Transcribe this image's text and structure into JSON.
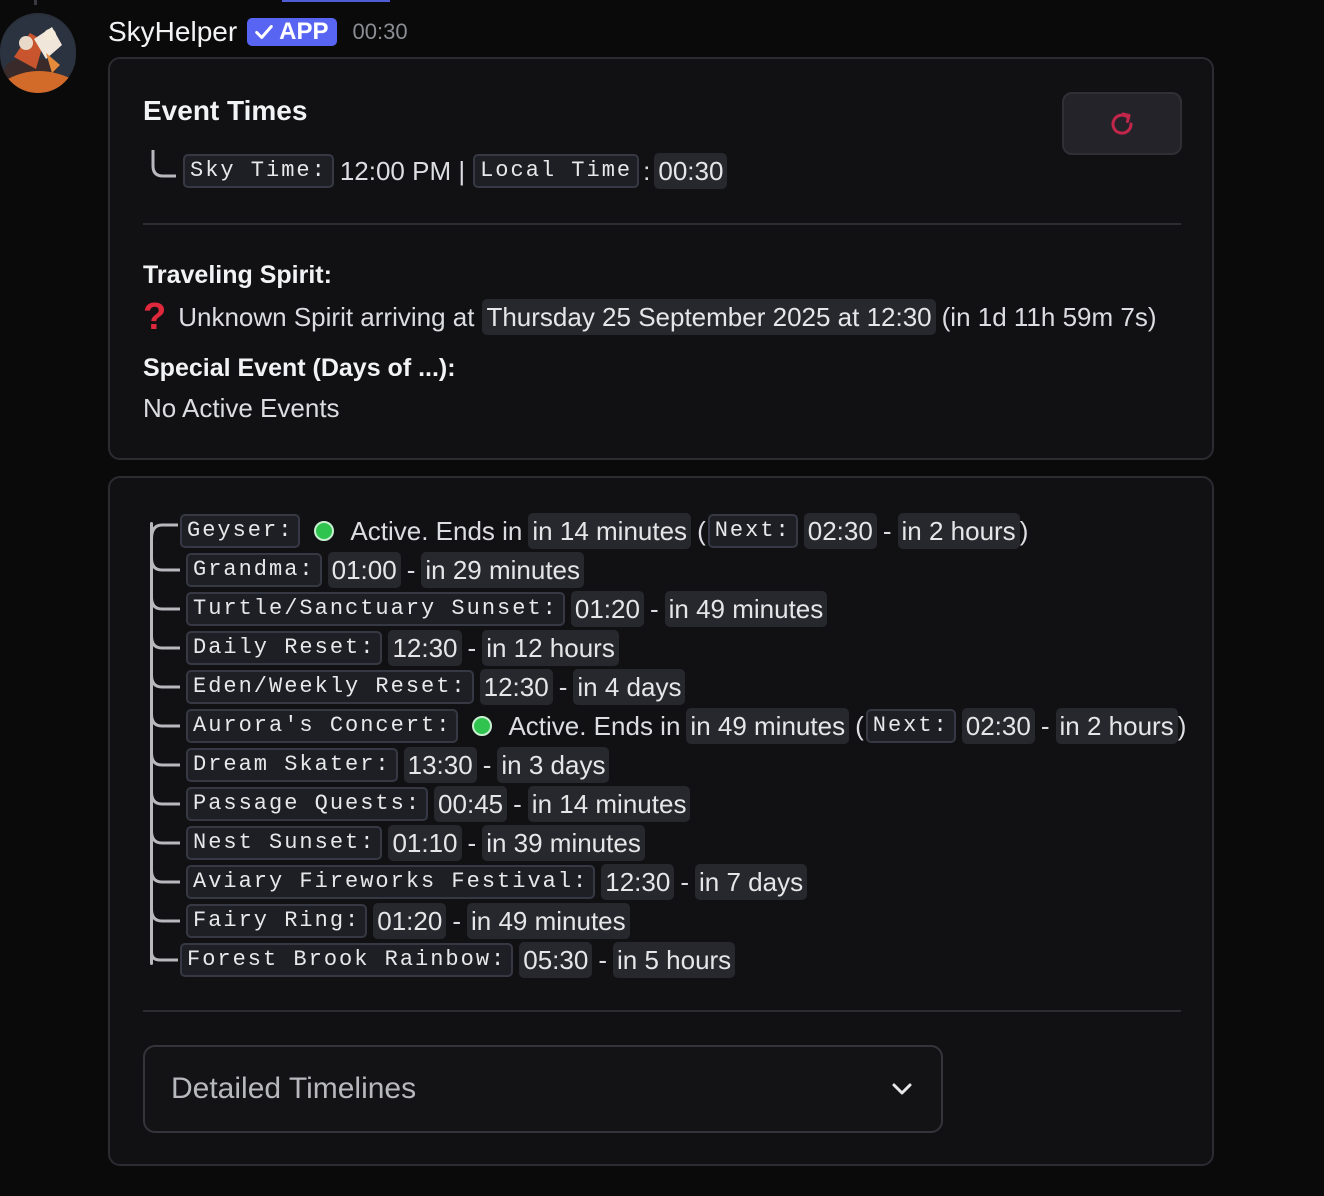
{
  "message": {
    "username": "SkyHelper",
    "badge": "APP",
    "timestamp": "00:30"
  },
  "card1": {
    "title": "Event Times",
    "sky_time_label": "Sky Time:",
    "sky_time_value": "12:00 PM |",
    "local_time_label": "Local Time",
    "local_time_colon": ":",
    "local_time_value": "00:30",
    "traveling_spirit_title": "Traveling Spirit:",
    "spirit_icon": "?",
    "spirit_text": "Unknown Spirit arriving at",
    "spirit_date": "Thursday 25 September 2025 at 12:30",
    "spirit_countdown": "(in 1d 11h 59m 7s)",
    "special_event_title": "Special Event (Days of ...):",
    "special_event_text": "No Active Events"
  },
  "events": [
    {
      "label": "Geyser:",
      "active": true,
      "active_text": "Active. Ends in",
      "ends": "in 14 minutes",
      "next_label": "Next:",
      "time": "02:30",
      "rel": "in 2 hours"
    },
    {
      "label": "Grandma:",
      "time": "01:00",
      "rel": "in 29 minutes"
    },
    {
      "label": "Turtle/Sanctuary Sunset:",
      "time": "01:20",
      "rel": "in 49 minutes"
    },
    {
      "label": "Daily Reset:",
      "time": "12:30",
      "rel": "in 12 hours"
    },
    {
      "label": "Eden/Weekly Reset:",
      "time": "12:30",
      "rel": "in 4 days"
    },
    {
      "label": "Aurora's Concert:",
      "active": true,
      "active_text": "Active. Ends in",
      "ends": "in 49 minutes",
      "next_label": "Next:",
      "time": "02:30",
      "rel": "in 2 hours"
    },
    {
      "label": "Dream Skater:",
      "time": "13:30",
      "rel": "in 3 days"
    },
    {
      "label": "Passage Quests:",
      "time": "00:45",
      "rel": "in 14 minutes"
    },
    {
      "label": "Nest Sunset:",
      "time": "01:10",
      "rel": "in 39 minutes"
    },
    {
      "label": "Aviary Fireworks Festival:",
      "time": "12:30",
      "rel": "in 7 days"
    },
    {
      "label": "Fairy Ring:",
      "time": "01:20",
      "rel": "in 49 minutes"
    },
    {
      "label": "Forest Brook Rainbow:",
      "time": "05:30",
      "rel": "in 5 hours"
    }
  ],
  "dash": "-",
  "open_paren": "(",
  "close_paren": ")",
  "dropdown": {
    "placeholder": "Detailed Timelines",
    "icon": "chevron-down-icon"
  },
  "icons": {
    "refresh": "refresh-icon",
    "verified": "check-icon",
    "spirit": "question-mark-icon"
  },
  "colors": {
    "badge": "#5865f2",
    "refresh_icon": "#c2264a",
    "spirit_icon": "#e0283c",
    "active_dot": "#2ec44e",
    "card_bg": "#111114"
  }
}
